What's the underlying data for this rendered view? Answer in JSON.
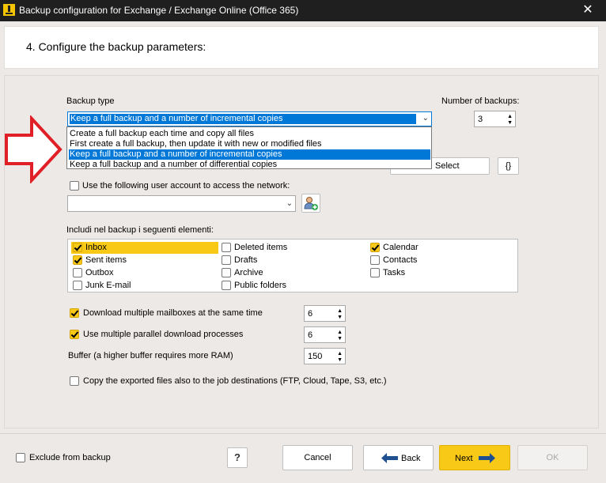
{
  "window": {
    "title": "Backup configuration for Exchange / Exchange Online (Office 365)",
    "close_glyph": "✕"
  },
  "header": {
    "step_title": "4. Configure the backup parameters:"
  },
  "backup_type": {
    "label": "Backup type",
    "selected": "Keep a full backup and a number of incremental copies",
    "options": [
      "Create a full backup each time and copy all files",
      "First create a full backup, then update it with new or modified files",
      "Keep a full backup and a number of incremental copies",
      "Keep a full backup and a number of differential copies"
    ],
    "selected_index": 2
  },
  "number_of_backups": {
    "label": "Number of backups:",
    "value": "3"
  },
  "select_button": {
    "label": "Select"
  },
  "braces_button": {
    "label": "{}"
  },
  "network": {
    "checkbox_label": "Use the following user account to access the network:",
    "checked": false,
    "account_value": ""
  },
  "include": {
    "label": "Includi nel backup i seguenti elementi:",
    "items": [
      {
        "label": "Inbox",
        "checked": true,
        "highlighted": true
      },
      {
        "label": "Deleted items",
        "checked": false
      },
      {
        "label": "Calendar",
        "checked": true
      },
      {
        "label": "Sent items",
        "checked": true
      },
      {
        "label": "Drafts",
        "checked": false
      },
      {
        "label": "Contacts",
        "checked": false
      },
      {
        "label": "Outbox",
        "checked": false
      },
      {
        "label": "Archive",
        "checked": false
      },
      {
        "label": "Tasks",
        "checked": false
      },
      {
        "label": "Junk E-mail",
        "checked": false
      },
      {
        "label": "Public folders",
        "checked": false
      }
    ]
  },
  "options": {
    "multiple_mailboxes": {
      "label": "Download multiple mailboxes at the same time",
      "checked": true,
      "value": "6"
    },
    "parallel_processes": {
      "label": "Use multiple parallel download processes",
      "checked": true,
      "value": "6"
    },
    "buffer": {
      "label": "Buffer (a higher buffer requires more RAM)",
      "value": "150"
    },
    "copy_exported": {
      "label": "Copy the exported files also to the job destinations (FTP, Cloud, Tape, S3, etc.)",
      "checked": false
    }
  },
  "footer": {
    "exclude_label": "Exclude from backup",
    "exclude_checked": false,
    "help_label": "?",
    "cancel_label": "Cancel",
    "back_label": "Back",
    "next_label": "Next",
    "ok_label": "OK"
  },
  "colors": {
    "accent_yellow": "#f9c918",
    "selection_blue": "#0078d7",
    "arrow_red": "#e01f26",
    "titlebar": "#1f1f1f"
  }
}
